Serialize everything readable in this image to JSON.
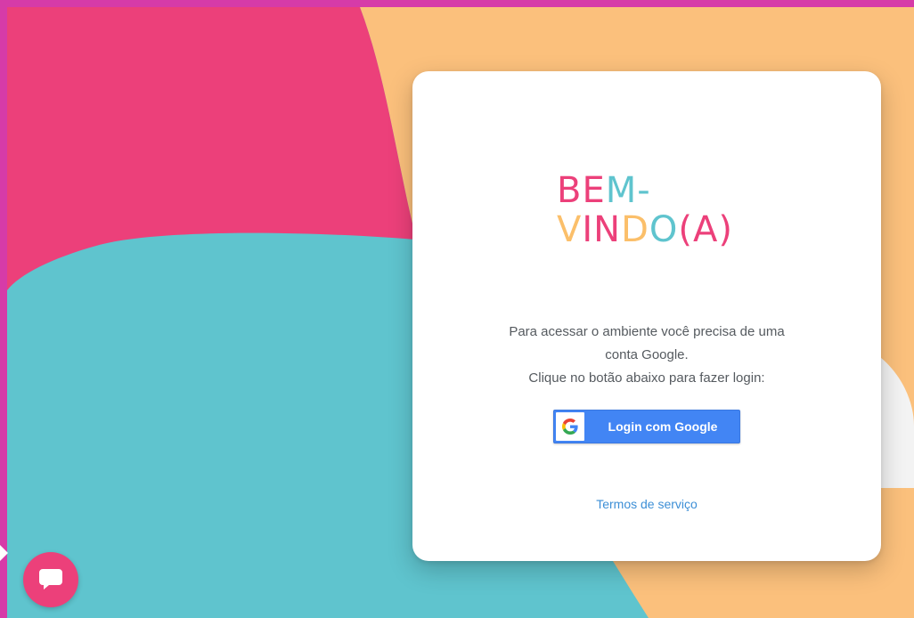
{
  "colors": {
    "frame": "#d63ba8",
    "pink": "#ec407a",
    "orange": "#fbc07c",
    "teal": "#5fc4ce",
    "card": "#ffffff",
    "google_blue": "#4285f4",
    "link": "#3d8fd6"
  },
  "welcome": {
    "line1": [
      {
        "char": "B",
        "color": "#ec407a"
      },
      {
        "char": "E",
        "color": "#ec407a"
      },
      {
        "char": "M",
        "color": "#5fc4ce"
      },
      {
        "char": "-",
        "color": "#5fc4ce"
      }
    ],
    "line2": [
      {
        "char": "V",
        "color": "#fbbf6a"
      },
      {
        "char": "I",
        "color": "#ec407a"
      },
      {
        "char": "N",
        "color": "#ec407a"
      },
      {
        "char": "D",
        "color": "#fbbf6a"
      },
      {
        "char": "O",
        "color": "#5fc4ce"
      },
      {
        "char": "(",
        "color": "#ec407a"
      },
      {
        "char": "A",
        "color": "#ec407a"
      },
      {
        "char": ")",
        "color": "#ec407a"
      }
    ]
  },
  "message": {
    "line1": "Para acessar o ambiente você precisa de uma",
    "line2": "conta Google.",
    "line3": "Clique no botão abaixo para fazer login:"
  },
  "login": {
    "icon": "google-g-icon",
    "label": "Login com Google"
  },
  "terms": {
    "label": "Termos de serviço"
  },
  "chat": {
    "icon": "chat-bubble-icon"
  }
}
